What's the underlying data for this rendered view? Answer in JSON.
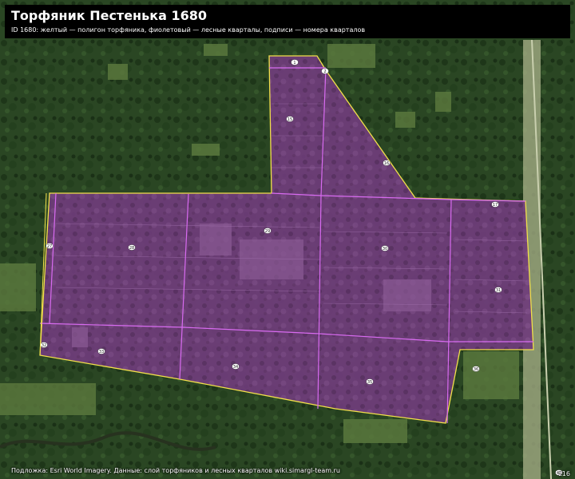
{
  "title": "Торфяник Пестенька 1680",
  "subtitle": "ID 1680: желтый — полигон торфяника, фиолетовый — лесные кварталы, подписи — номера кварталов",
  "attribution": "Подложка: Esri World Imagery. Данные: слой торфяников и лесных кварталов wiki.simargl-team.ru",
  "scale_label": "z16",
  "colors": {
    "peat_outline": "#f2e04a",
    "quarter_line": "#d86bf0",
    "peat_fill": "#7a3d86",
    "forest_dark": "#1f3a1c",
    "forest_light": "#3e5e2c"
  },
  "quarters": [
    {
      "num": "1"
    },
    {
      "num": "2"
    },
    {
      "num": "15"
    },
    {
      "num": "16"
    },
    {
      "num": "17"
    },
    {
      "num": "27"
    },
    {
      "num": "28"
    },
    {
      "num": "29"
    },
    {
      "num": "30"
    },
    {
      "num": "31"
    },
    {
      "num": "32"
    },
    {
      "num": "33"
    },
    {
      "num": "34"
    },
    {
      "num": "35"
    },
    {
      "num": "36"
    },
    {
      "num": "45"
    }
  ]
}
